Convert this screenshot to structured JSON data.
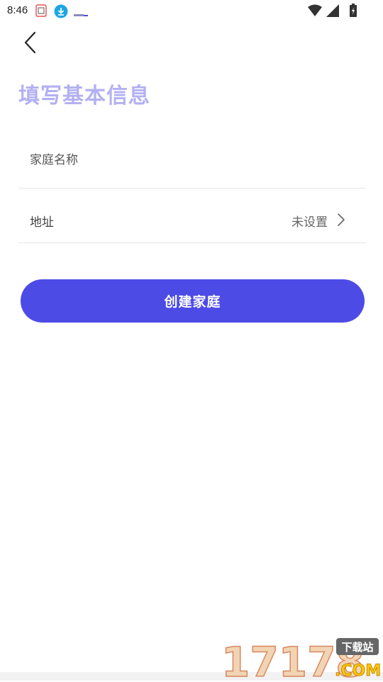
{
  "status_bar": {
    "time": "8:46",
    "icons": [
      "sim-card-icon",
      "download-icon",
      "notification-app-icon",
      "wifi-icon",
      "signal-icon",
      "battery-icon"
    ]
  },
  "header": {
    "back_icon": "chevron-left-icon",
    "title": "填写基本信息"
  },
  "form": {
    "home_name": {
      "value": "",
      "placeholder": "家庭名称"
    },
    "address": {
      "label": "地址",
      "value": "未设置",
      "icon": "chevron-right-icon"
    }
  },
  "actions": {
    "create_label": "创建家庭"
  },
  "colors": {
    "accent": "#4c4be6",
    "title": "#b3b0f2",
    "divider": "#e6e6e6"
  },
  "watermark": {
    "number": "17178",
    "suffix": ".COM",
    "badge": "下载站"
  }
}
